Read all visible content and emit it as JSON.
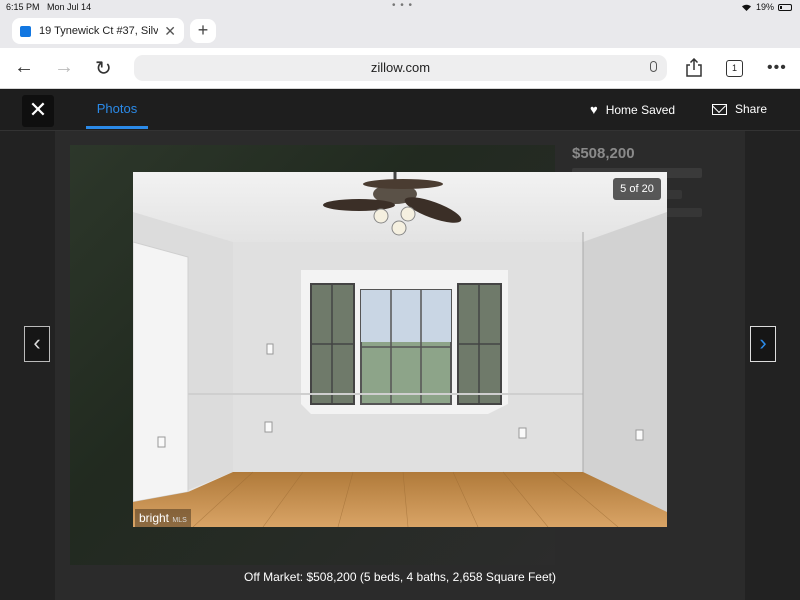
{
  "status_bar": {
    "time": "6:15 PM",
    "date": "Mon Jul 14",
    "battery": "19%",
    "battery_level": 0.19,
    "icons": [
      "wifi-icon",
      "battery-icon"
    ]
  },
  "tab": {
    "title": "19 Tynewick Ct #37, Silv",
    "favicon": "zillow-icon",
    "close": "✕",
    "new_tab": "+"
  },
  "address_bar": {
    "url": "zillow.com",
    "back": "←",
    "forward": "→",
    "reload": "↻",
    "tab_count": "1",
    "more": "•••"
  },
  "photo_viewer": {
    "close": "✕",
    "tab_label": "Photos",
    "home_saved": "Home Saved",
    "share": "Share",
    "counter": "5 of 20",
    "watermark": "bright",
    "watermark_sub": "MLS",
    "caption": "Off Market: $508,200 (5 beds, 4 baths, 2,658 Square Feet)",
    "prev": "‹",
    "next": "›"
  },
  "background_listing": {
    "price": "$508,200"
  },
  "colors": {
    "accent": "#2b8ae8",
    "overlay": "#1e1e1e"
  }
}
